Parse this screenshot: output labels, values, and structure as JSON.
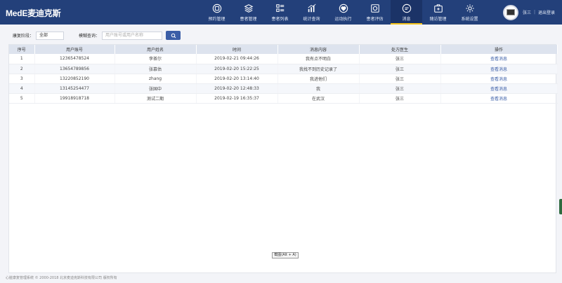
{
  "header": {
    "logo_text": "MedE麦迪克斯",
    "nav": [
      {
        "label": "预约管理",
        "icon": "calendar-icon"
      },
      {
        "label": "患者管理",
        "icon": "layers-icon"
      },
      {
        "label": "患者列表",
        "icon": "list-icon"
      },
      {
        "label": "统计查询",
        "icon": "bar-chart-icon"
      },
      {
        "label": "运动执行",
        "icon": "heart-icon"
      },
      {
        "label": "患者评估",
        "icon": "assessment-icon"
      },
      {
        "label": "消息",
        "icon": "message-icon"
      },
      {
        "label": "随访管理",
        "icon": "briefcase-icon"
      },
      {
        "label": "系统设置",
        "icon": "gear-icon"
      }
    ],
    "active_nav": "消息",
    "user_name": "张三",
    "separator": "|",
    "logout": "退出登录"
  },
  "filter": {
    "stage_label": "康复阶段：",
    "stage_value": "全部",
    "fuzzy_label": "模糊查询：",
    "search_placeholder": "用户账号或用户名称"
  },
  "table": {
    "columns": [
      "序号",
      "用户账号",
      "用户姓名",
      "时间",
      "消息内容",
      "处方医生",
      "操作"
    ],
    "rows": [
      {
        "index": "1",
        "account": "12365478524",
        "name": "李茶尔",
        "time": "2019-02-21 09:44:26",
        "message": "我有点不明白",
        "doctor": "张三",
        "action": "查看消息"
      },
      {
        "index": "2",
        "account": "13654789856",
        "name": "张慕估",
        "time": "2019-02-20 15:22:25",
        "message": "我找不到历史记录了",
        "doctor": "张三",
        "action": "查看消息"
      },
      {
        "index": "3",
        "account": "13220852190",
        "name": "zhang",
        "time": "2019-02-20 13:14:40",
        "message": "我进他们",
        "doctor": "张三",
        "action": "查看消息"
      },
      {
        "index": "4",
        "account": "13145254477",
        "name": "张国中",
        "time": "2019-02-20 12:48:33",
        "message": "我",
        "doctor": "张三",
        "action": "查看消息"
      },
      {
        "index": "5",
        "account": "19918918718",
        "name": "测试二期",
        "time": "2019-02-19 16:35:37",
        "message": "在武汉",
        "doctor": "张三",
        "action": "查看消息"
      }
    ]
  },
  "screenshot_tip": "截图(Alt + A)",
  "footer": "心脏康复管理系统 © 2000-2018 北京麦迪克斯科技有限公司 版权所有"
}
